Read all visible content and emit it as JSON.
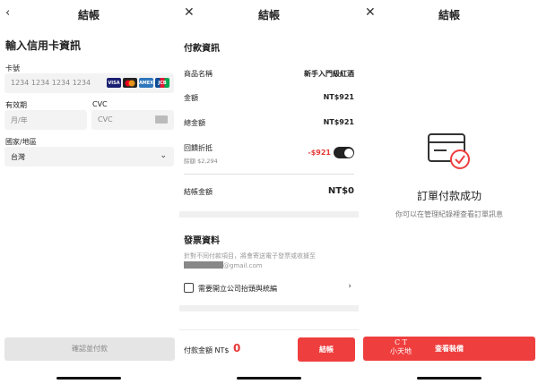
{
  "header": {
    "title": "結帳",
    "back_icon": "‹",
    "close_icon": "✕"
  },
  "card_form": {
    "heading": "輸入信用卡資訊",
    "card_number_label": "卡號",
    "card_number_placeholder": "1234 1234 1234 1234",
    "card_brands": [
      "VISA",
      "mastercard",
      "AMEX",
      "JCB"
    ],
    "expiry_label": "有效期",
    "expiry_placeholder": "月/年",
    "cvc_label": "CVC",
    "cvc_placeholder": "CVC",
    "country_label": "國家/地區",
    "country_value": "台灣",
    "submit_label": "確認並付款"
  },
  "payment": {
    "section_title": "付款資訊",
    "product_label": "商品名稱",
    "product_value": "新手入門級紅酒",
    "amount_label": "金額",
    "amount_value": "NT$921",
    "total_label": "總金額",
    "total_value": "NT$921",
    "rebate_label": "回饋折抵",
    "rebate_balance": "餘額 $2,294",
    "rebate_value": "-$921",
    "checkout_label": "結帳金額",
    "checkout_value": "NT$0"
  },
  "invoice": {
    "section_title": "發票資料",
    "note_line1": "針對不同付款項目，將會寄送電子發票或收據至",
    "email_suffix": "@gmail.com",
    "company_checkbox_label": "需要開立公司抬頭與統編"
  },
  "bottom_bar": {
    "pay_label": "付款金額 NT$",
    "pay_value": "0",
    "checkout_button": "結帳"
  },
  "success": {
    "title": "訂單付款成功",
    "subtitle": "你可以在管理紀錄裡查看訂單訊息",
    "view_button": "查看裝備",
    "watermark_line1": "C T",
    "watermark_line2": "小天地"
  },
  "colors": {
    "accent": "#ef3e3e",
    "negative": "#e53935"
  }
}
